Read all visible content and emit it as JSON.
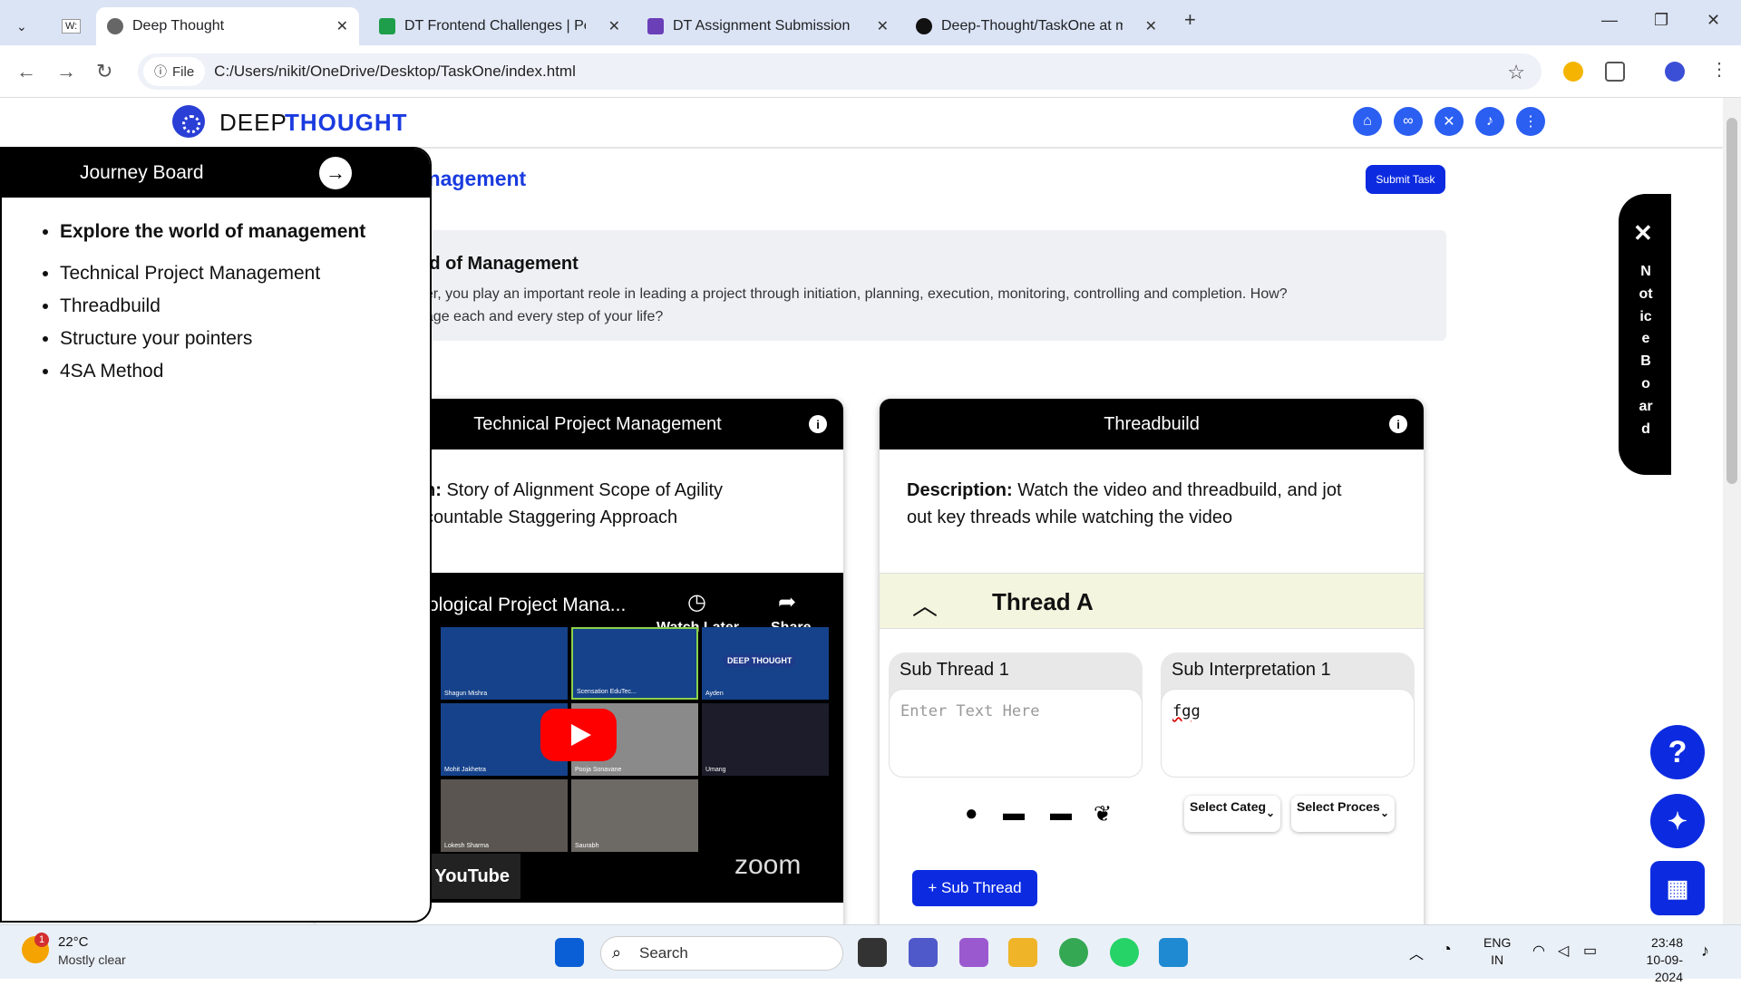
{
  "browser": {
    "tabs": [
      {
        "title": "Deep Thought",
        "active": true
      },
      {
        "title": "DT Frontend Challenges | PeerB",
        "active": false
      },
      {
        "title": "DT Assignment Submission",
        "active": false
      },
      {
        "title": "Deep-Thought/TaskOne at main",
        "active": false
      }
    ],
    "new_tab": "+",
    "file_chip": "File",
    "url": "C:/Users/nikit/OneDrive/Desktop/TaskOne/index.html"
  },
  "header": {
    "logo_deep": "DEEP",
    "logo_thought": "THOUGHT",
    "icons": [
      "home-icon",
      "binoculars-icon",
      "tools-icon",
      "bell-icon",
      "more-icon"
    ]
  },
  "task": {
    "title": "ect Management",
    "submit_label": "Submit Task",
    "intro_title": "rld of Management",
    "intro_text_1": "ger, you play an important reole in leading a project through initiation, planning, execution, monitoring, controlling and completion. How?",
    "intro_text_2": "nage each and every step of your life?"
  },
  "journey": {
    "title": "Journey Board",
    "items": [
      {
        "label": "Explore the world of management",
        "bold": true
      },
      {
        "label": "Technical Project Management",
        "bold": false
      },
      {
        "label": "Threadbuild",
        "bold": false
      },
      {
        "label": "Structure your pointers",
        "bold": false
      },
      {
        "label": "4SA Method",
        "bold": false
      }
    ]
  },
  "card_tpm": {
    "title": "Technical Project Management",
    "desc_prefix": "n:",
    "desc_1": " Story of Alignment Scope of Agility",
    "desc_2": "countable Staggering Approach",
    "video": {
      "title": "ological Project Mana...",
      "watch_later": "Watch Later",
      "share": "Share",
      "youtube": "YouTube",
      "zoom": "zoom",
      "participants": [
        "Shagun Mishra",
        "Scensation EduTec...",
        "Ayden",
        "Mohit Jakhetra",
        "Pooja Sonavane",
        "Umang",
        "Lokesh Sharma",
        "Saurabh"
      ],
      "logo_text": "DEEP THOUGHT"
    }
  },
  "card_thread": {
    "title": "Threadbuild",
    "desc_label": "Description:",
    "desc_1": " Watch the video and threadbuild, and jot",
    "desc_2": "out key threads while watching the video",
    "thread_title": "Thread A",
    "sub_thread_label": "Sub Thread 1",
    "sub_thread_placeholder": "Enter Text Here",
    "sub_interp_label": "Sub Interpretation 1",
    "sub_interp_value": "fgg",
    "select_category": "Select Categ",
    "select_process": "Select Proces",
    "add_sub_thread": "+ Sub Thread"
  },
  "notice": {
    "close": "✕",
    "letters": "NoticeBoard"
  },
  "taskbar": {
    "weather_badge": "1",
    "temp": "22°C",
    "condition": "Mostly clear",
    "search": "Search",
    "lang_1": "ENG",
    "lang_2": "IN",
    "time": "23:48",
    "date": "10-09-2024"
  },
  "colors": {
    "brand_blue": "#1a3be0",
    "button_blue": "#0c2be0",
    "thread_bar": "#f3f5de"
  }
}
